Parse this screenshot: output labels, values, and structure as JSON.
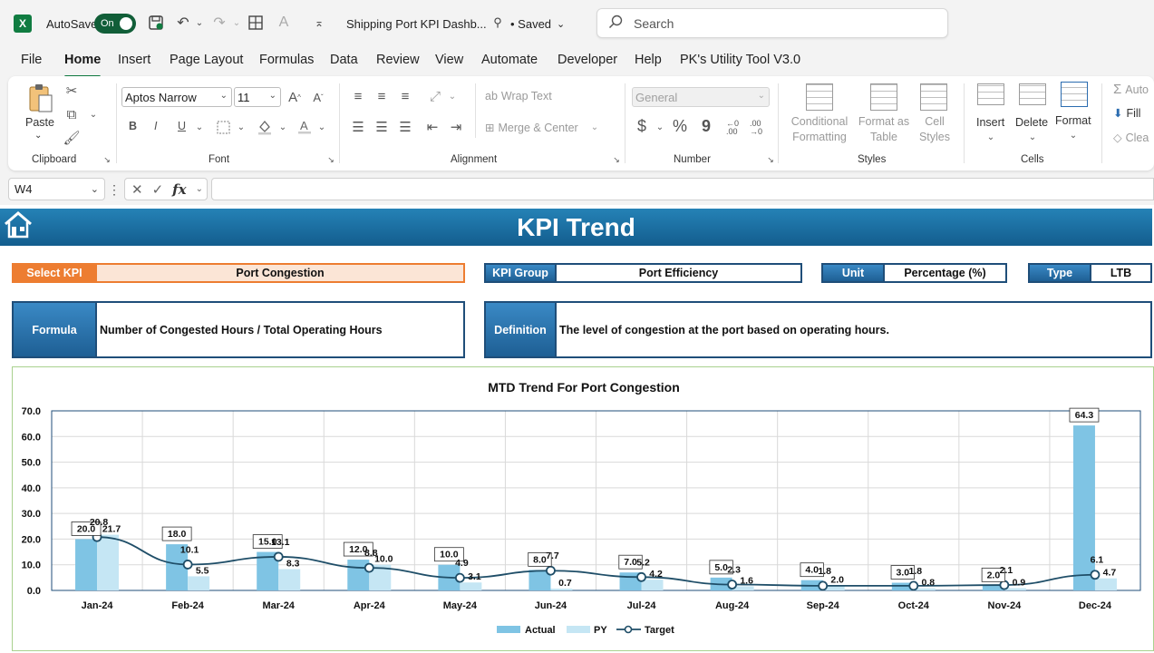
{
  "titlebar": {
    "app_icon_letter": "X",
    "autosave_label": "AutoSave",
    "autosave_state": "On",
    "doc_title": "Shipping Port KPI Dashb...",
    "save_state": "• Saved",
    "search_placeholder": "Search"
  },
  "menu": {
    "tabs": [
      "File",
      "Home",
      "Insert",
      "Page Layout",
      "Formulas",
      "Data",
      "Review",
      "View",
      "Automate",
      "Developer",
      "Help",
      "PK's Utility Tool V3.0"
    ],
    "active": "Home"
  },
  "ribbon": {
    "clipboard": {
      "label": "Clipboard",
      "paste": "Paste"
    },
    "font": {
      "label": "Font",
      "name": "Aptos Narrow",
      "size": "11",
      "bold": "B",
      "italic": "I",
      "underline": "U"
    },
    "alignment": {
      "label": "Alignment",
      "wrap_text": "Wrap Text",
      "merge_center": "Merge & Center"
    },
    "number": {
      "label": "Number",
      "format": "General",
      "currency": "$",
      "percent": "%",
      "comma": "9"
    },
    "styles": {
      "label": "Styles",
      "conditional": [
        "Conditional",
        "Formatting"
      ],
      "format_table": [
        "Format as",
        "Table"
      ],
      "cell_styles": [
        "Cell",
        "Styles"
      ]
    },
    "cells": {
      "label": "Cells",
      "insert": "Insert",
      "delete": "Delete",
      "format": "Format"
    },
    "editing": {
      "autosum": "Auto",
      "fill": "Fill",
      "clear": "Clea"
    }
  },
  "formula_bar": {
    "cell_ref": "W4",
    "fx": "fx",
    "content": ""
  },
  "sheet": {
    "banner_title": "KPI Trend",
    "select_kpi_label": "Select KPI",
    "select_kpi_value": "Port Congestion",
    "kpi_group_label": "KPI Group",
    "kpi_group_value": "Port Efficiency",
    "unit_label": "Unit",
    "unit_value": "Percentage (%)",
    "type_label": "Type",
    "type_value": "LTB",
    "formula_label": "Formula",
    "formula_value": "Number of Congested Hours / Total Operating Hours",
    "definition_label": "Definition",
    "definition_value": "The level of congestion at the port based on operating hours."
  },
  "chart_data": {
    "type": "bar",
    "title": "MTD Trend For Port Congestion",
    "categories": [
      "Jan-24",
      "Feb-24",
      "Mar-24",
      "Apr-24",
      "May-24",
      "Jun-24",
      "Jul-24",
      "Aug-24",
      "Sep-24",
      "Oct-24",
      "Nov-24",
      "Dec-24"
    ],
    "series": [
      {
        "name": "Actual",
        "type": "bar",
        "color": "#7fc4e4",
        "values": [
          20.0,
          18.0,
          15.0,
          12.0,
          10.0,
          8.0,
          7.0,
          5.0,
          4.0,
          3.0,
          2.0,
          64.3
        ]
      },
      {
        "name": "PY",
        "type": "bar",
        "color": "#c5e6f4",
        "values": [
          21.7,
          5.5,
          8.3,
          10.0,
          3.1,
          0.7,
          4.2,
          1.6,
          2.0,
          0.8,
          0.9,
          4.7
        ]
      },
      {
        "name": "Target",
        "type": "line",
        "color": "#1f4e68",
        "values": [
          20.8,
          10.1,
          13.1,
          8.8,
          4.9,
          7.7,
          5.2,
          2.3,
          1.8,
          1.8,
          2.1,
          6.1
        ]
      }
    ],
    "ylim": [
      0,
      70
    ],
    "yticks": [
      "0.0",
      "10.0",
      "20.0",
      "30.0",
      "40.0",
      "50.0",
      "60.0",
      "70.0"
    ],
    "legend": "bottom",
    "grid": true
  }
}
